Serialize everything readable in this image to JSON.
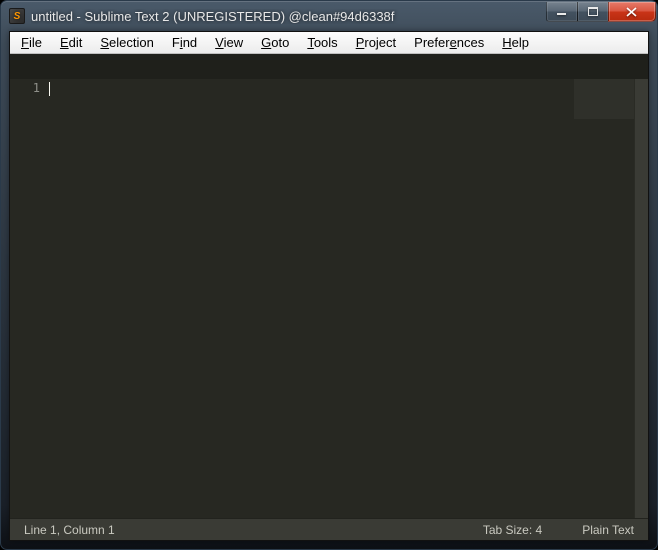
{
  "window": {
    "title": "untitled - Sublime Text 2 (UNREGISTERED) @clean#94d6338f",
    "app_icon_letter": "S"
  },
  "menubar": {
    "items": [
      {
        "label": "File",
        "accel_index": 0
      },
      {
        "label": "Edit",
        "accel_index": 0
      },
      {
        "label": "Selection",
        "accel_index": 0
      },
      {
        "label": "Find",
        "accel_index": 1
      },
      {
        "label": "View",
        "accel_index": 0
      },
      {
        "label": "Goto",
        "accel_index": 0
      },
      {
        "label": "Tools",
        "accel_index": 0
      },
      {
        "label": "Project",
        "accel_index": 0
      },
      {
        "label": "Preferences",
        "accel_index": 6
      },
      {
        "label": "Help",
        "accel_index": 0
      }
    ]
  },
  "editor": {
    "line_number": "1"
  },
  "statusbar": {
    "position": "Line 1, Column 1",
    "tab_size": "Tab Size: 4",
    "syntax": "Plain Text"
  }
}
